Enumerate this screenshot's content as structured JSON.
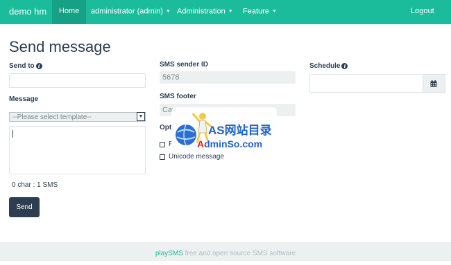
{
  "navbar": {
    "brand": "demo hm",
    "items": [
      {
        "label": "Home",
        "active": true
      },
      {
        "label": "administrator (admin)",
        "dropdown": true
      },
      {
        "label": "Administration",
        "dropdown": true
      },
      {
        "label": "Feature",
        "dropdown": true
      }
    ],
    "logout": "Logout"
  },
  "page": {
    "title": "Send message"
  },
  "form": {
    "send_to": {
      "label": "Send to",
      "value": ""
    },
    "message": {
      "label": "Message",
      "template_select": "--Please select template--",
      "text": ""
    },
    "sms_sender_id": {
      "label": "SMS sender ID",
      "value": "5678"
    },
    "sms_footer": {
      "label": "SMS footer",
      "value": "Cav"
    },
    "options": {
      "label": "Opti",
      "flash_label": "F",
      "unicode_label": "Unicode message"
    },
    "schedule": {
      "label": "Schedule",
      "value": ""
    },
    "counter": "0 char : 1 SMS",
    "send_button": "Send"
  },
  "footer": {
    "brand": "playSMS",
    "text": " free and open source SMS software"
  },
  "watermark": {
    "line1": "AS网站目录",
    "line2_red": "A",
    "line2_rest": "dminSo.com"
  },
  "colors": {
    "navbar": "#1abc9c",
    "navbar_active": "#16a085",
    "primary_dark": "#2c3e50",
    "footer_bg": "#ecf0f1"
  },
  "icons": {
    "info": "info-circle-icon",
    "calendar": "calendar-icon",
    "caret": "caret-down-icon"
  }
}
